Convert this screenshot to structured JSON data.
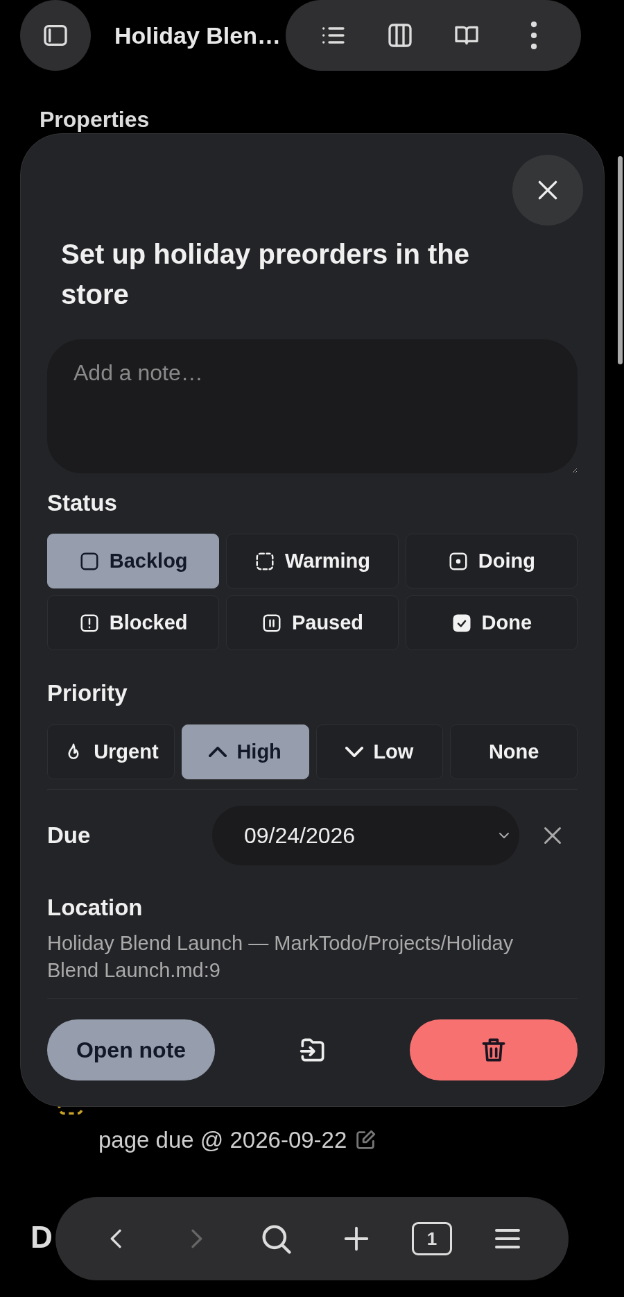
{
  "header": {
    "title": "Holiday Blen…"
  },
  "page": {
    "section_heading": "Properties",
    "task_line_2": "page due @ 2026-09-22",
    "next_heading": "D"
  },
  "dialog": {
    "title": "Set up holiday preorders in the store",
    "note": {
      "placeholder": "Add a note…"
    },
    "status_label": "Status",
    "statuses": [
      {
        "label": "Backlog",
        "kind": "backlog",
        "selected": true
      },
      {
        "label": "Warming",
        "kind": "warming",
        "selected": false
      },
      {
        "label": "Doing",
        "kind": "doing",
        "selected": false
      },
      {
        "label": "Blocked",
        "kind": "blocked",
        "selected": false
      },
      {
        "label": "Paused",
        "kind": "paused",
        "selected": false
      },
      {
        "label": "Done",
        "kind": "done",
        "selected": false
      }
    ],
    "priority_label": "Priority",
    "priorities": [
      {
        "label": "Urgent",
        "kind": "urgent",
        "selected": false
      },
      {
        "label": "High",
        "kind": "high",
        "selected": true
      },
      {
        "label": "Low",
        "kind": "low",
        "selected": false
      },
      {
        "label": "None",
        "kind": "none",
        "selected": false
      }
    ],
    "due_label": "Due",
    "due_value": "09/24/2026",
    "location_label": "Location",
    "location_path": "Holiday Blend Launch — MarkTodo/Projects/Holiday Blend Launch.md:9",
    "open_button": "Open note"
  },
  "bottom_bar": {
    "tab_count": "1"
  }
}
